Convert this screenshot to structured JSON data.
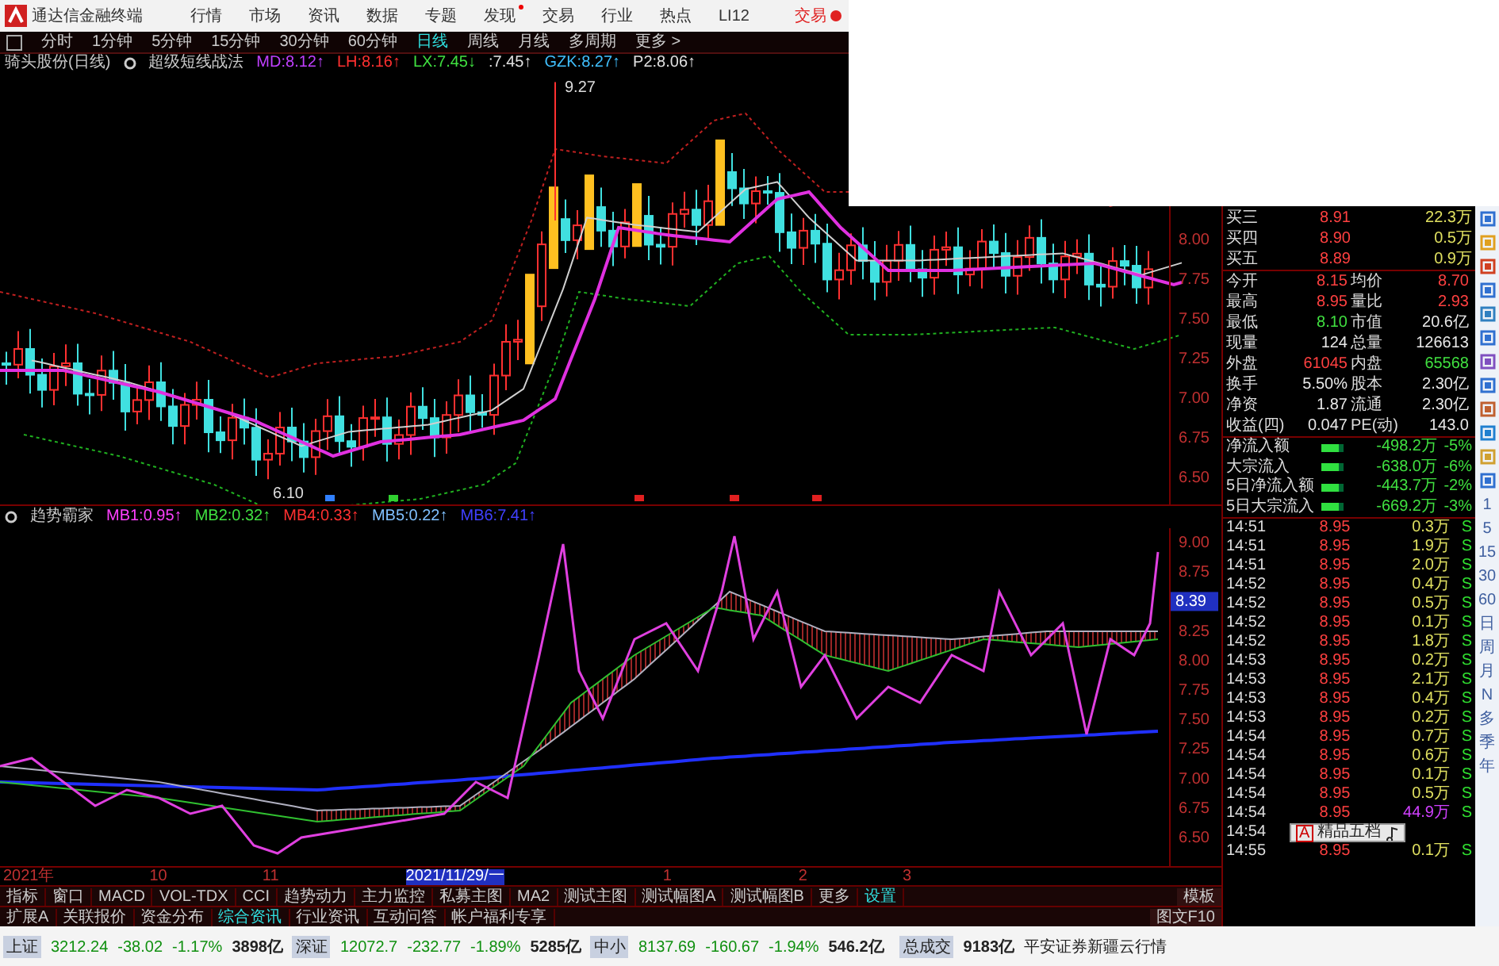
{
  "menu_bar": {
    "app_title": "通达信金融终端",
    "items": [
      {
        "label": "行情",
        "badge": false
      },
      {
        "label": "市场",
        "badge": false
      },
      {
        "label": "资讯",
        "badge": false
      },
      {
        "label": "数据",
        "badge": false
      },
      {
        "label": "专题",
        "badge": false
      },
      {
        "label": "发现",
        "badge": true
      },
      {
        "label": "交易",
        "badge": false
      },
      {
        "label": "行业",
        "badge": false
      },
      {
        "label": "热点",
        "badge": false
      },
      {
        "label": "LI12",
        "badge": false
      }
    ],
    "trade_button": "交易"
  },
  "period_bar": {
    "items": [
      {
        "label": "分时",
        "selected": false
      },
      {
        "label": "1分钟",
        "selected": false
      },
      {
        "label": "5分钟",
        "selected": false
      },
      {
        "label": "15分钟",
        "selected": false
      },
      {
        "label": "30分钟",
        "selected": false
      },
      {
        "label": "60分钟",
        "selected": false
      },
      {
        "label": "日线",
        "selected": true
      },
      {
        "label": "周线",
        "selected": false
      },
      {
        "label": "月线",
        "selected": false
      },
      {
        "label": "多周期",
        "selected": false
      },
      {
        "label": "更多 >",
        "selected": false
      }
    ]
  },
  "main_chart": {
    "legend": [
      {
        "text": "骑头股份(日线)",
        "color": "#c8c8c8"
      },
      {
        "text": "超级短线战法",
        "color": "#c8c8c8"
      },
      {
        "text": "MD:8.12↑",
        "color": "#c040ff"
      },
      {
        "text": "LH:8.16↑",
        "color": "#ff3030"
      },
      {
        "text": "LX:7.45↓",
        "color": "#40e040"
      },
      {
        "text": ":7.45↑",
        "color": "#e0e0e0"
      },
      {
        "text": "GZK:8.27↑",
        "color": "#40c0ff"
      },
      {
        "text": "P2:8.06↑",
        "color": "#e0e0e0"
      }
    ],
    "peak_label": "9.27",
    "low_label": "6.10",
    "price_labels": [
      "8.00",
      "7.75",
      "7.50",
      "7.25",
      "7.00",
      "6.75",
      "6.50"
    ]
  },
  "indicator_chart": {
    "legend": [
      {
        "text": "趋势霸家",
        "color": "#c8c8c8"
      },
      {
        "text": "MB1:0.95↑",
        "color": "#ff40ff"
      },
      {
        "text": "MB2:0.32↑",
        "color": "#40e040"
      },
      {
        "text": "MB4:0.33↑",
        "color": "#ff3030"
      },
      {
        "text": "MB5:0.22↑",
        "color": "#80c0ff"
      },
      {
        "text": "MB6:7.41↑",
        "color": "#4040ff"
      }
    ],
    "price_labels": [
      {
        "text": "9.00",
        "selected": false
      },
      {
        "text": "8.75",
        "selected": false
      },
      {
        "text": "8.39",
        "selected": true
      },
      {
        "text": "8.25",
        "selected": false
      },
      {
        "text": "8.00",
        "selected": false
      },
      {
        "text": "7.75",
        "selected": false
      },
      {
        "text": "7.50",
        "selected": false
      },
      {
        "text": "7.25",
        "selected": false
      },
      {
        "text": "7.00",
        "selected": false
      },
      {
        "text": "6.75",
        "selected": false
      },
      {
        "text": "6.50",
        "selected": false
      }
    ]
  },
  "date_axis": [
    {
      "label": "2021年",
      "selected": false
    },
    {
      "label": "10",
      "selected": false
    },
    {
      "label": "11",
      "selected": false
    },
    {
      "label": "2021/11/29/一",
      "selected": true
    },
    {
      "label": "1",
      "selected": false
    },
    {
      "label": "2",
      "selected": false
    },
    {
      "label": "3",
      "selected": false
    }
  ],
  "indicator_tabs": {
    "items": [
      {
        "label": "指标",
        "selected": false
      },
      {
        "label": "窗口",
        "selected": false
      },
      {
        "label": "MACD",
        "selected": false
      },
      {
        "label": "VOL-TDX",
        "selected": false
      },
      {
        "label": "CCI",
        "selected": false
      },
      {
        "label": "趋势动力",
        "selected": false
      },
      {
        "label": "主力监控",
        "selected": false
      },
      {
        "label": "私募主图",
        "selected": false
      },
      {
        "label": "MA2",
        "selected": false
      },
      {
        "label": "测试主图",
        "selected": false
      },
      {
        "label": "测试幅图A",
        "selected": false
      },
      {
        "label": "测试幅图B",
        "selected": false
      },
      {
        "label": "更多",
        "selected": false
      },
      {
        "label": "设置",
        "selected": true
      }
    ],
    "template_button": "模板"
  },
  "info_tabs": {
    "items": [
      {
        "label": "扩展A",
        "selected": false
      },
      {
        "label": "关联报价",
        "selected": false
      },
      {
        "label": "资金分布",
        "selected": false
      },
      {
        "label": "综合资讯",
        "selected": true
      },
      {
        "label": "行业资讯",
        "selected": false
      },
      {
        "label": "互动问答",
        "selected": false
      },
      {
        "label": "帐户福利专享",
        "selected": false
      }
    ],
    "f10_button": "图文F10"
  },
  "quote_panel": {
    "book": [
      {
        "label": "买三",
        "price": "8.91",
        "volume": "22.3万"
      },
      {
        "label": "买四",
        "price": "8.90",
        "volume": "0.5万"
      },
      {
        "label": "买五",
        "price": "8.89",
        "volume": "0.9万"
      }
    ],
    "stats": [
      {
        "cells": [
          {
            "label": "今开",
            "value": "8.15",
            "color": "#ff4040"
          },
          {
            "label": "均价",
            "value": "8.70",
            "color": "#ff4040"
          }
        ]
      },
      {
        "cells": [
          {
            "label": "最高",
            "value": "8.95",
            "color": "#ff4040"
          },
          {
            "label": "量比",
            "value": "2.93",
            "color": "#ff4040"
          }
        ]
      },
      {
        "cells": [
          {
            "label": "最低",
            "value": "8.10",
            "color": "#40e040"
          },
          {
            "label": "市值",
            "value": "20.6亿",
            "color": "#e8e8e8"
          }
        ]
      },
      {
        "cells": [
          {
            "label": "现量",
            "value": "124",
            "color": "#e8e8e8"
          },
          {
            "label": "总量",
            "value": "126613",
            "color": "#e8e8e8"
          }
        ]
      },
      {
        "cells": [
          {
            "label": "外盘",
            "value": "61045",
            "color": "#ff4040"
          },
          {
            "label": "内盘",
            "value": "65568",
            "color": "#40e040"
          }
        ]
      },
      {
        "cells": [
          {
            "label": "换手",
            "value": "5.50%",
            "color": "#e8e8e8"
          },
          {
            "label": "股本",
            "value": "2.30亿",
            "color": "#e8e8e8"
          }
        ]
      },
      {
        "cells": [
          {
            "label": "净资",
            "value": "1.87",
            "color": "#e8e8e8"
          },
          {
            "label": "流通",
            "value": "2.30亿",
            "color": "#e8e8e8"
          }
        ]
      },
      {
        "cells": [
          {
            "label": "收益(四)",
            "value": "0.047",
            "color": "#e8e8e8"
          },
          {
            "label": "PE(动)",
            "value": "143.0",
            "color": "#e8e8e8"
          }
        ]
      }
    ],
    "flows": [
      {
        "label": "净流入额",
        "level": 0.8,
        "amount": "-498.2万",
        "percent": "-5%"
      },
      {
        "label": "大宗流入",
        "level": 0.8,
        "amount": "-638.0万",
        "percent": "-6%"
      },
      {
        "label": "5日净流入额",
        "level": 0.8,
        "amount": "-443.7万",
        "percent": "-2%"
      },
      {
        "label": "5日大宗流入",
        "level": 0.8,
        "amount": "-669.2万",
        "percent": "-3%"
      }
    ],
    "trades": [
      {
        "kind": "normal",
        "time": "14:51",
        "price": "8.95",
        "volume": "0.3万",
        "side": "S"
      },
      {
        "kind": "normal",
        "time": "14:51",
        "price": "8.95",
        "volume": "1.9万",
        "side": "S"
      },
      {
        "kind": "normal",
        "time": "14:51",
        "price": "8.95",
        "volume": "2.0万",
        "side": "S"
      },
      {
        "kind": "normal",
        "time": "14:52",
        "price": "8.95",
        "volume": "0.4万",
        "side": "S"
      },
      {
        "kind": "normal",
        "time": "14:52",
        "price": "8.95",
        "volume": "0.5万",
        "side": "S"
      },
      {
        "kind": "normal",
        "time": "14:52",
        "price": "8.95",
        "volume": "0.1万",
        "side": "S"
      },
      {
        "kind": "normal",
        "time": "14:52",
        "price": "8.95",
        "volume": "1.8万",
        "side": "S"
      },
      {
        "kind": "normal",
        "time": "14:53",
        "price": "8.95",
        "volume": "0.2万",
        "side": "S"
      },
      {
        "kind": "normal",
        "time": "14:53",
        "price": "8.95",
        "volume": "2.1万",
        "side": "S"
      },
      {
        "kind": "normal",
        "time": "14:53",
        "price": "8.95",
        "volume": "0.4万",
        "side": "S"
      },
      {
        "kind": "normal",
        "time": "14:53",
        "price": "8.95",
        "volume": "0.2万",
        "side": "S"
      },
      {
        "kind": "normal",
        "time": "14:54",
        "price": "8.95",
        "volume": "0.7万",
        "side": "S"
      },
      {
        "kind": "normal",
        "time": "14:54",
        "price": "8.95",
        "volume": "0.6万",
        "side": "S"
      },
      {
        "kind": "normal",
        "time": "14:54",
        "price": "8.95",
        "volume": "0.1万",
        "side": "S"
      },
      {
        "kind": "normal",
        "time": "14:54",
        "price": "8.95",
        "volume": "0.5万",
        "side": "S"
      },
      {
        "kind": "big",
        "time": "14:54",
        "price": "8.95",
        "volume": "44.9万",
        "side": "S"
      },
      {
        "kind": "covered",
        "time": "14:54"
      },
      {
        "kind": "normal",
        "time": "14:55",
        "price": "8.95",
        "volume": "0.1万",
        "side": "S"
      }
    ],
    "popup": {
      "key": "A",
      "label": "精品五档"
    }
  },
  "sidebar": {
    "periods": [
      "1",
      "5",
      "15",
      "30",
      "60",
      "日",
      "周",
      "月",
      "N",
      "多",
      "季",
      "年"
    ]
  },
  "status_bar": {
    "indices": [
      {
        "name": "上证",
        "value": "3212.24",
        "change": "-38.02",
        "percent": "-1.17%",
        "turnover": "3898亿"
      },
      {
        "name": "深证",
        "value": "12072.7",
        "change": "-232.77",
        "percent": "-1.89%",
        "turnover": "5285亿"
      },
      {
        "name": "中小",
        "value": "8137.69",
        "change": "-160.67",
        "percent": "-1.94%",
        "turnover": "546.2亿"
      }
    ],
    "total_label": "总成交",
    "total_value": "9183亿",
    "broker": "平安证券新疆云行情"
  }
}
